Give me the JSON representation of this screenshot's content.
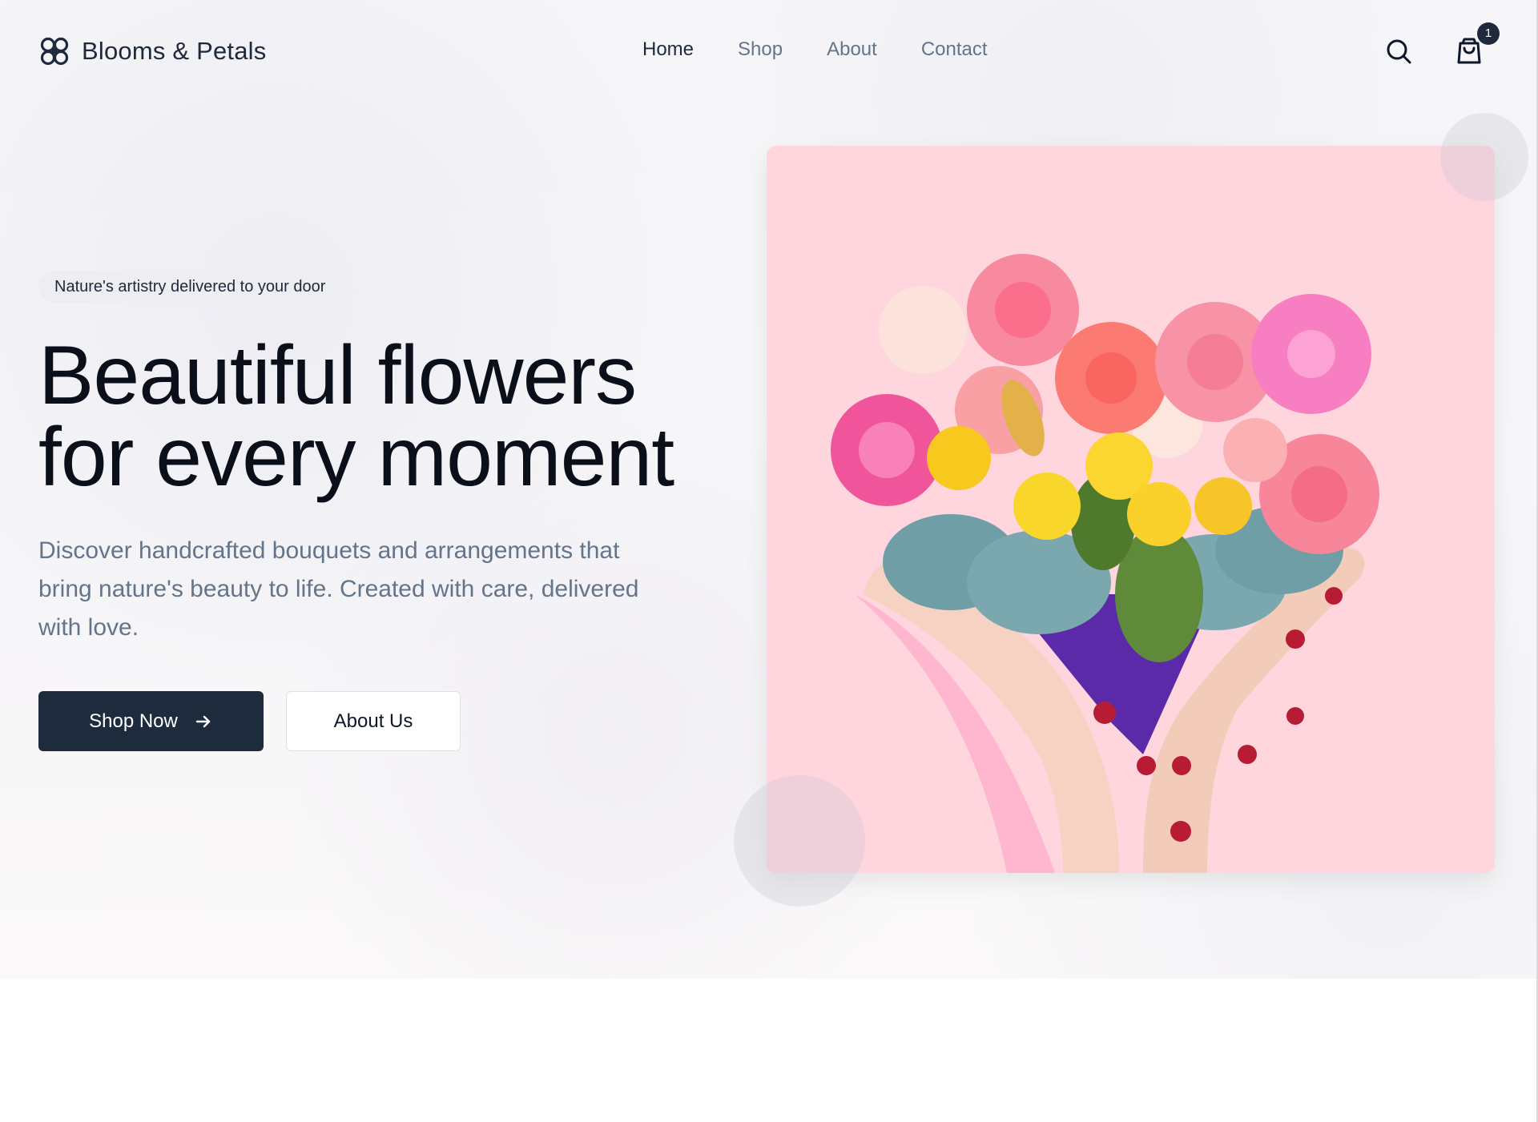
{
  "brand": {
    "name": "Blooms & Petals",
    "logo_icon": "flower-logo-icon"
  },
  "nav": {
    "items": [
      {
        "label": "Home",
        "active": true
      },
      {
        "label": "Shop",
        "active": false
      },
      {
        "label": "About",
        "active": false
      },
      {
        "label": "Contact",
        "active": false
      }
    ]
  },
  "header_actions": {
    "search_icon": "search-icon",
    "cart_icon": "shopping-bag-icon",
    "cart_count": "1"
  },
  "hero": {
    "tagline": "Nature's artistry delivered to your door",
    "headline_line1": "Beautiful flowers",
    "headline_line2": "for every moment",
    "description": "Discover handcrafted bouquets and arrangements that bring nature's beauty to life. Created with care, delivered with love.",
    "primary_button": "Shop Now",
    "primary_button_icon": "arrow-right-icon",
    "secondary_button": "About Us",
    "image_subject": "Heart-shaped flower bouquet held by two hands on a pink background"
  },
  "colors": {
    "primary": "#1e2b3d",
    "muted_text": "#64748b",
    "card_background": "#ffd5de",
    "tag_background": "#eceef2"
  }
}
